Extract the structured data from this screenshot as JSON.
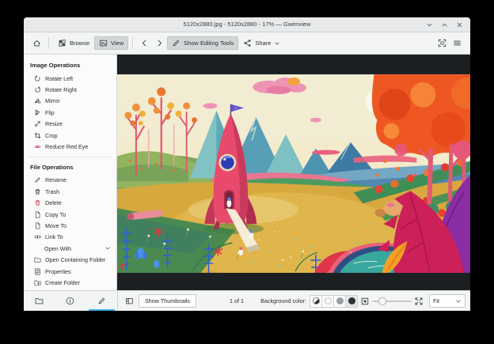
{
  "window": {
    "title": "5120x2880.jpg - 5120x2880 - 17% — Gwenview"
  },
  "toolbar": {
    "browse": "Browse",
    "view": "View",
    "show_editing_tools": "Show Editing Tools",
    "share": "Share"
  },
  "sidebar": {
    "sections": [
      {
        "title": "Image Operations",
        "items": [
          {
            "label": "Rotate Left",
            "icon": "rotate-left-icon"
          },
          {
            "label": "Rotate Right",
            "icon": "rotate-right-icon"
          },
          {
            "label": "Mirror",
            "icon": "mirror-icon"
          },
          {
            "label": "Flip",
            "icon": "flip-icon"
          },
          {
            "label": "Resize",
            "icon": "resize-icon"
          },
          {
            "label": "Crop",
            "icon": "crop-icon"
          },
          {
            "label": "Reduce Red Eye",
            "icon": "red-eye-icon"
          }
        ]
      },
      {
        "title": "File Operations",
        "items": [
          {
            "label": "Rename",
            "icon": "rename-icon"
          },
          {
            "label": "Trash",
            "icon": "trash-icon"
          },
          {
            "label": "Delete",
            "icon": "delete-icon"
          },
          {
            "label": "Copy To",
            "icon": "copy-icon"
          },
          {
            "label": "Move To",
            "icon": "move-icon"
          },
          {
            "label": "Link To",
            "icon": "link-icon"
          },
          {
            "label": "Open With",
            "icon": "none"
          },
          {
            "label": "Open Containing Folder",
            "icon": "folder-icon"
          },
          {
            "label": "Properties",
            "icon": "properties-icon"
          },
          {
            "label": "Create Folder",
            "icon": "create-folder-icon"
          }
        ]
      }
    ]
  },
  "statusbar": {
    "show_thumbnails": "Show Thumbnails",
    "position": "1 of 1",
    "background_color_label": "Background color:",
    "zoom_mode": "Fit"
  },
  "colors": {
    "accent": "#3daee9",
    "delete_red": "#d5485a",
    "viewer_background": "#1d2023",
    "toolbar_pressed": "#d3d7d8"
  }
}
